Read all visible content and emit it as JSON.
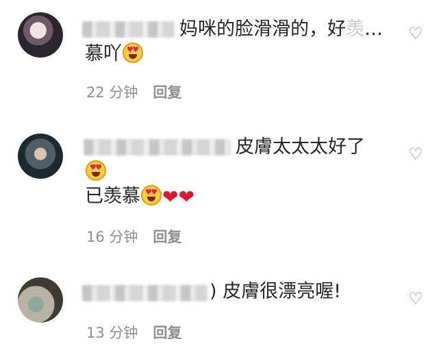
{
  "comments": [
    {
      "line1": "妈咪的脸滑滑的，好",
      "line1_faded": "羡",
      "line1_more": "…",
      "line2": "慕吖",
      "time": "22 分钟",
      "reply_label": "回复",
      "like_icon": "heart-outline-icon"
    },
    {
      "line1": "皮膚太太太好了",
      "line3": "已羡慕",
      "time": "16 分钟",
      "reply_label": "回复",
      "like_icon": "heart-outline-icon"
    },
    {
      "line1_prefix": ")",
      "line1": "皮膚很漂亮喔!",
      "time": "13 分钟",
      "reply_label": "回复",
      "like_icon": "heart-outline-icon"
    }
  ],
  "colors": {
    "text": "#262626",
    "meta": "#8e8e8e",
    "emoji_face": "#ffce3d",
    "heart": "#e0162b"
  }
}
